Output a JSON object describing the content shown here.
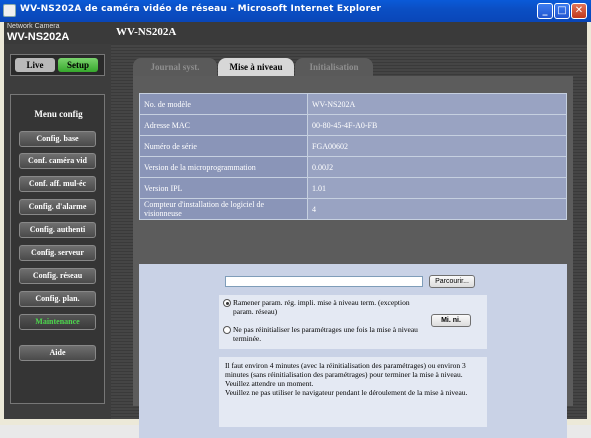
{
  "window": {
    "title": "WV-NS202A de caméra vidéo de réseau - Microsoft Internet Explorer"
  },
  "header": {
    "logo_small": "Network Camera",
    "logo_large": "WV-NS202A",
    "model": "WV-NS202A"
  },
  "mode": {
    "live": "Live",
    "setup": "Setup"
  },
  "menu": {
    "title": "Menu config",
    "items": [
      {
        "label": "Config. base"
      },
      {
        "label": "Conf. caméra vid"
      },
      {
        "label": "Conf. aff. mul-éc"
      },
      {
        "label": "Config. d'alarme"
      },
      {
        "label": "Config. authenti"
      },
      {
        "label": "Config. serveur"
      },
      {
        "label": "Config. réseau"
      },
      {
        "label": "Config. plan."
      },
      {
        "label": "Maintenance"
      },
      {
        "label": "Aide"
      }
    ],
    "active_color": "#4cd84c"
  },
  "tabs": [
    {
      "label": "Journal syst."
    },
    {
      "label": "Mise à niveau"
    },
    {
      "label": "Initialisation"
    }
  ],
  "info": [
    {
      "label": "No. de modèle",
      "value": "WV-NS202A"
    },
    {
      "label": "Adresse MAC",
      "value": "00-80-45-4F-A0-FB"
    },
    {
      "label": "Numéro de série",
      "value": "FGA00602"
    },
    {
      "label": "Version de la microprogrammation",
      "value": "0.00J2"
    },
    {
      "label": "Version IPL",
      "value": "1.01"
    },
    {
      "label": "Compteur d'installation de logiciel de visionneuse",
      "value": "4"
    }
  ],
  "upgrade": {
    "file_value": "",
    "browse_label": "Parcourir...",
    "option1": "Ramener param. rég. impli. mise à niveau term. (exception param. réseau)",
    "option2": "Ne pas réinitialiser les paramétrages une fois la mise à niveau terminée.",
    "execute_label": "Mi. ni.",
    "note": "Il faut environ 4 minutes (avec la réinitialisation des paramétrages) ou environ 3 minutes (sans réinitialisation des paramétrages) pour terminer la mise à niveau.\nVeuillez attendre un moment.\nVeuillez ne pas utiliser le navigateur pendant le déroulement de la mise à niveau."
  }
}
